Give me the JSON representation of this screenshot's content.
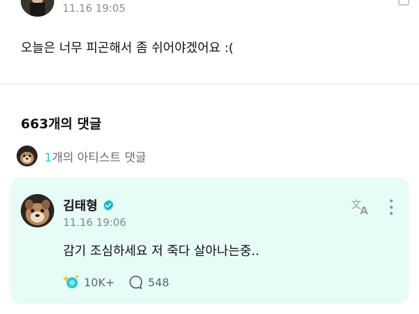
{
  "post": {
    "time": "11.16 19:05",
    "text": "오늘은 너무 피곤해서 좀 쉬어야겠어요 :("
  },
  "comments": {
    "count_label": "663개의 댓글",
    "artist_count": "1",
    "artist_label": "개의 아티스트 댓글"
  },
  "comment": {
    "author": "김태형",
    "time": "11.16 19:06",
    "text": "감기 조심하세요 저 죽다 살아나는중..",
    "likes": "10K+",
    "replies": "548"
  },
  "colors": {
    "accent": "#1ec9d2",
    "card_background": "#e7fbf7",
    "verified": "#15b8c4"
  },
  "icons": {
    "verified": "verified-badge-icon",
    "translate": "translate-icon",
    "more": "more-vertical-icon",
    "like": "like-sparkle-icon",
    "reply": "speech-bubble-icon"
  }
}
